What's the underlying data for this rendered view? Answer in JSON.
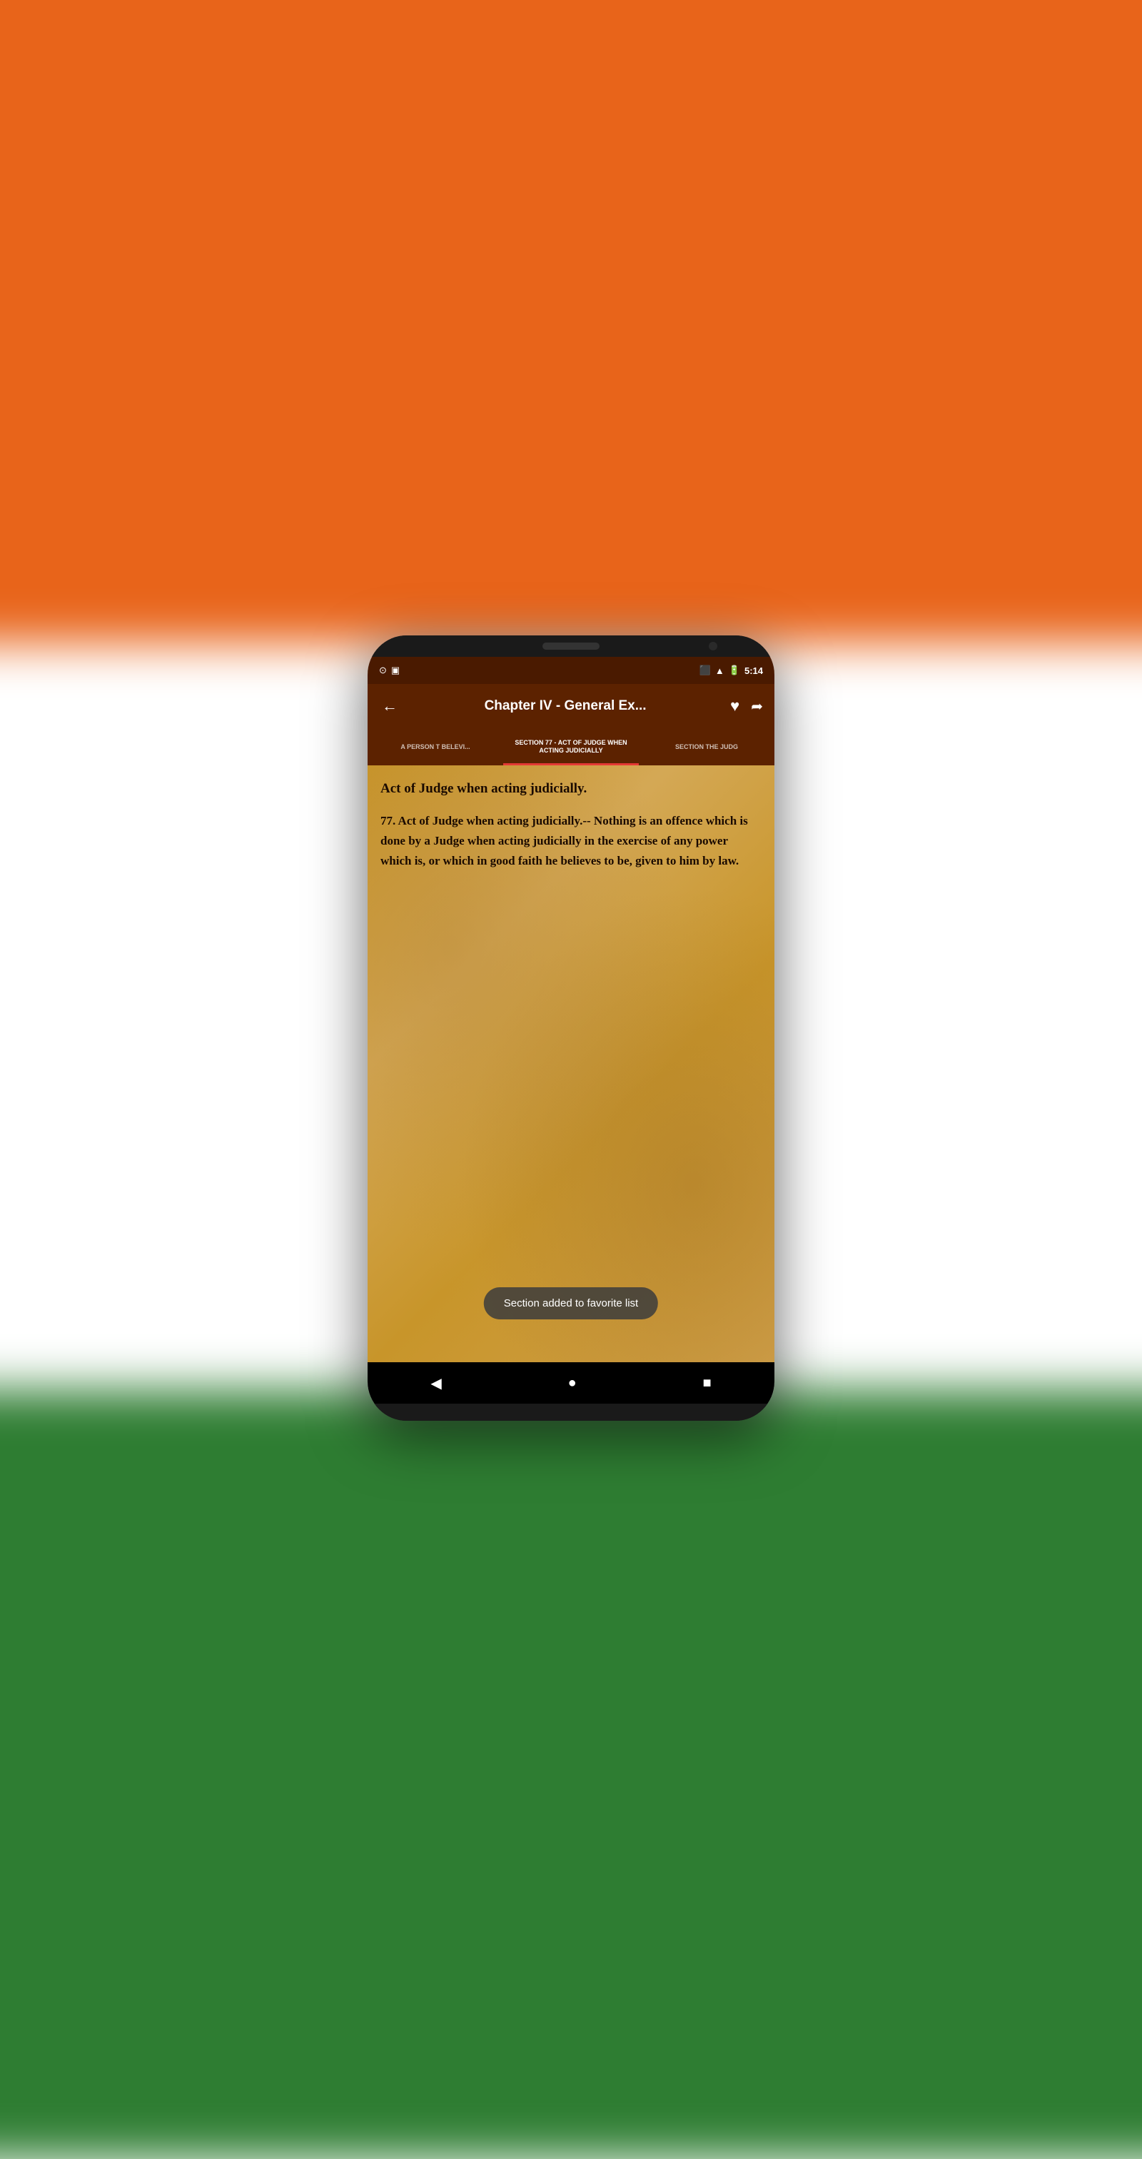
{
  "background": {
    "colors": [
      "#e8641a",
      "#ffffff",
      "#2e7d32"
    ]
  },
  "status_bar": {
    "left_icons": [
      "camera-icon",
      "sim-icon"
    ],
    "right_icons": [
      "cast-icon",
      "signal-icon",
      "battery-icon"
    ],
    "time": "5:14"
  },
  "toolbar": {
    "back_label": "←",
    "title": "Chapter IV - General Ex...",
    "favorite_icon": "heart-icon",
    "share_icon": "share-icon"
  },
  "tabs": [
    {
      "id": "prev",
      "label": "A PERSON T BELEVI...",
      "active": false
    },
    {
      "id": "current",
      "label": "SECTION 77 - ACT OF JUDGE WHEN ACTING JUDICIALLY",
      "active": true
    },
    {
      "id": "next",
      "label": "SECTION THE JUDG",
      "active": false
    }
  ],
  "content": {
    "section_heading": "Act of Judge when acting judicially.",
    "section_body": "77. Act of Judge when acting judicially.-- Nothing is an offence which is done by a Judge when acting judicially in the exercise of any power which is, or which in good faith he believes to be, given to him by law."
  },
  "toast": {
    "message": "Section added to favorite list"
  },
  "bottom_nav": {
    "back_icon": "◀",
    "home_icon": "●",
    "recents_icon": "■"
  }
}
